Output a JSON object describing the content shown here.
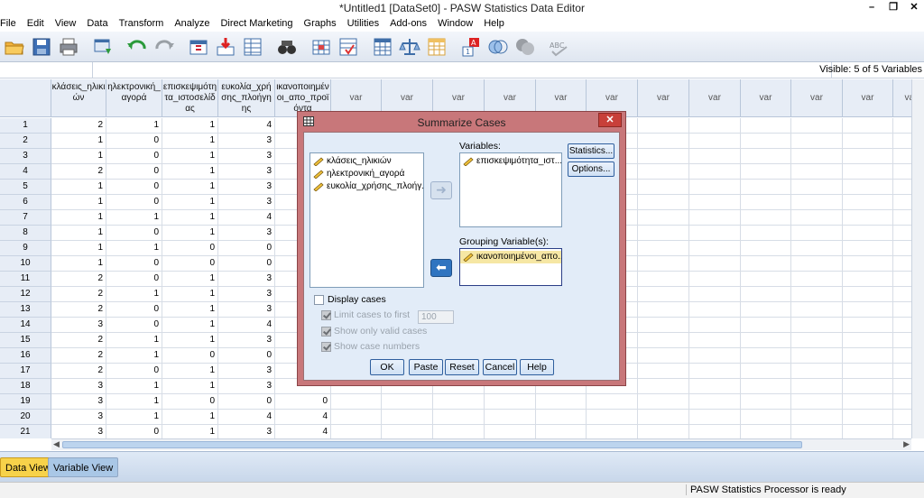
{
  "window": {
    "title": "*Untitled1 [DataSet0] - PASW Statistics Data Editor",
    "minimize": "–",
    "restore": "❐",
    "close": "✕"
  },
  "menu": [
    "File",
    "Edit",
    "View",
    "Data",
    "Transform",
    "Analyze",
    "Direct Marketing",
    "Graphs",
    "Utilities",
    "Add-ons",
    "Window",
    "Help"
  ],
  "toolbar_icons": [
    "open-folder-icon",
    "save-icon",
    "print-icon",
    "dialog-recall-icon",
    "undo-icon",
    "redo-icon",
    "goto-case-icon",
    "goto-variable-icon",
    "variables-icon",
    "find-icon",
    "insert-cases-icon",
    "insert-variable-icon",
    "split-file-icon",
    "weight-cases-icon",
    "select-cases-icon",
    "value-labels-icon",
    "use-sets-icon",
    "show-all-variables-icon",
    "spell-check-icon"
  ],
  "editrow": {
    "visible": "Visible: 5 of 5 Variables"
  },
  "grid": {
    "columns": [
      "κλάσεις_ηλικιών",
      "ηλεκτρονική_αγορά",
      "επισκεψιμότητα_ιστοσελίδας",
      "ευκολία_χρήσης_πλοήγησης",
      "ικανοποιημένοι_απο_προϊόντα"
    ],
    "column_headers_display": [
      "κλάσεις_ηλικι\nών",
      "ηλεκτρονική_\nαγορά",
      "επισκεψιμότη\nτα_ιστοσελίδ\nας",
      "ευκολία_χρή\nσης_πλοήγη\nης",
      "ικανοποιημέν\nοι_απο_προϊ\nόντα"
    ],
    "var_label": "var",
    "rows": [
      [
        "1",
        "2",
        "1",
        "1",
        "4",
        ""
      ],
      [
        "2",
        "1",
        "0",
        "1",
        "3",
        ""
      ],
      [
        "3",
        "1",
        "0",
        "1",
        "3",
        ""
      ],
      [
        "4",
        "2",
        "0",
        "1",
        "3",
        ""
      ],
      [
        "5",
        "1",
        "0",
        "1",
        "3",
        ""
      ],
      [
        "6",
        "1",
        "0",
        "1",
        "3",
        ""
      ],
      [
        "7",
        "1",
        "1",
        "1",
        "4",
        ""
      ],
      [
        "8",
        "1",
        "0",
        "1",
        "3",
        ""
      ],
      [
        "9",
        "1",
        "1",
        "0",
        "0",
        ""
      ],
      [
        "10",
        "1",
        "0",
        "0",
        "0",
        ""
      ],
      [
        "11",
        "2",
        "0",
        "1",
        "3",
        ""
      ],
      [
        "12",
        "2",
        "1",
        "1",
        "3",
        ""
      ],
      [
        "13",
        "2",
        "0",
        "1",
        "3",
        ""
      ],
      [
        "14",
        "3",
        "0",
        "1",
        "4",
        ""
      ],
      [
        "15",
        "2",
        "1",
        "1",
        "3",
        ""
      ],
      [
        "16",
        "2",
        "1",
        "0",
        "0",
        ""
      ],
      [
        "17",
        "2",
        "0",
        "1",
        "3",
        ""
      ],
      [
        "18",
        "3",
        "1",
        "1",
        "3",
        ""
      ],
      [
        "19",
        "3",
        "1",
        "0",
        "0",
        "0"
      ],
      [
        "20",
        "3",
        "1",
        "1",
        "4",
        "4"
      ],
      [
        "21",
        "3",
        "0",
        "1",
        "3",
        "4"
      ]
    ]
  },
  "tabs": {
    "data_view": "Data View",
    "variable_view": "Variable View"
  },
  "status": {
    "message": "PASW Statistics Processor is ready"
  },
  "dialog": {
    "title": "Summarize Cases",
    "close": "✕",
    "source_items": [
      "κλάσεις_ηλικιών",
      "ηλεκτρονική_αγορά",
      "ευκολία_χρήσης_πλοήγ..."
    ],
    "variables_label": "Variables:",
    "variables_items": [
      "επισκεψιμότητα_ιστ..."
    ],
    "grouping_label": "Grouping Variable(s):",
    "grouping_items": [
      "ικανοποιημένοι_απο..."
    ],
    "statistics_button": "Statistics...",
    "options_button": "Options...",
    "display_cases": "Display cases",
    "limit_cases": "Limit cases to first",
    "limit_value": "100",
    "show_valid": "Show only valid cases",
    "show_case_numbers": "Show case numbers",
    "ok": "OK",
    "paste": "Paste",
    "reset": "Reset",
    "cancel": "Cancel",
    "help": "Help"
  }
}
